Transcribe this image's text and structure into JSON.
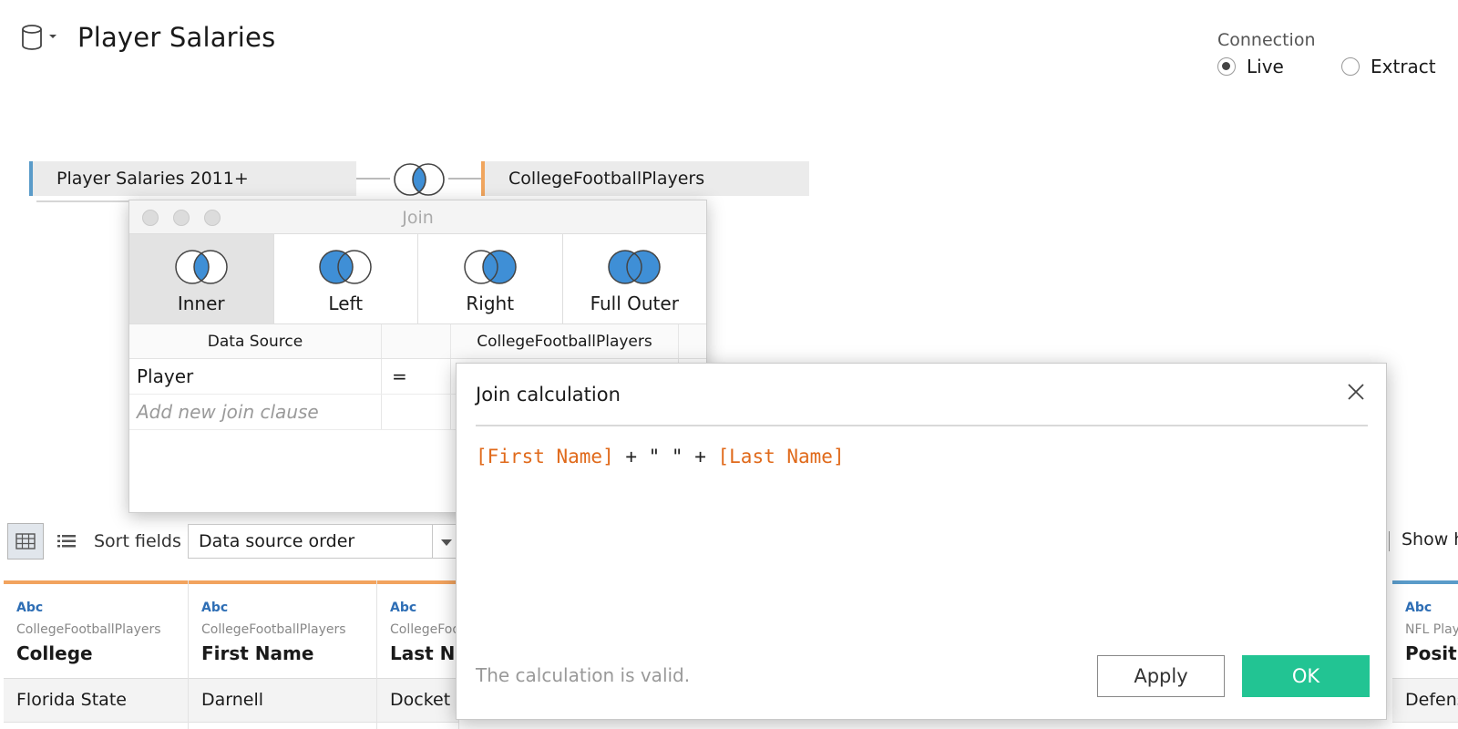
{
  "header": {
    "title": "Player Salaries",
    "connection_label": "Connection",
    "connection_options": [
      {
        "label": "Live",
        "selected": true
      },
      {
        "label": "Extract",
        "selected": false
      }
    ]
  },
  "canvas": {
    "left_table": "Player Salaries 2011+",
    "right_table": "CollegeFootballPlayers",
    "left_color": "#5a9bc9",
    "right_color": "#f0a55e",
    "join_icon": "inner-join-venn-icon"
  },
  "join_dialog": {
    "title": "Join",
    "types": [
      {
        "label": "Inner",
        "selected": true,
        "icon": "inner-join-icon"
      },
      {
        "label": "Left",
        "selected": false,
        "icon": "left-join-icon"
      },
      {
        "label": "Right",
        "selected": false,
        "icon": "right-join-icon"
      },
      {
        "label": "Full Outer",
        "selected": false,
        "icon": "full-outer-join-icon"
      }
    ],
    "columns": {
      "left": "Data Source",
      "right": "CollegeFootballPlayers"
    },
    "clauses": [
      {
        "left": "Player",
        "op": "="
      }
    ],
    "add_clause": "Add new join clause"
  },
  "toolbar": {
    "sort_label": "Sort fields",
    "sort_value": "Data source order",
    "show_hidden": "Show h"
  },
  "grid": {
    "columns": [
      {
        "type": "Abc",
        "source": "CollegeFootballPlayers",
        "name": "College",
        "value": "Florida State"
      },
      {
        "type": "Abc",
        "source": "CollegeFootballPlayers",
        "name": "First Name",
        "value": "Darnell"
      },
      {
        "type": "Abc",
        "source": "CollegeFoo",
        "name": "Last Na",
        "value": "Docket"
      },
      {
        "type": "Abc",
        "source": "NFL Playe",
        "name": "Positio",
        "value": "Defens"
      }
    ]
  },
  "calc_dialog": {
    "title": "Join calculation",
    "formula": {
      "field1": "[First Name]",
      "op1": " + \" \" + ",
      "field2": "[Last Name]"
    },
    "status": "The calculation is valid.",
    "apply_label": "Apply",
    "ok_label": "OK",
    "field_color": "#e06a1b",
    "ok_color": "#22c493"
  }
}
